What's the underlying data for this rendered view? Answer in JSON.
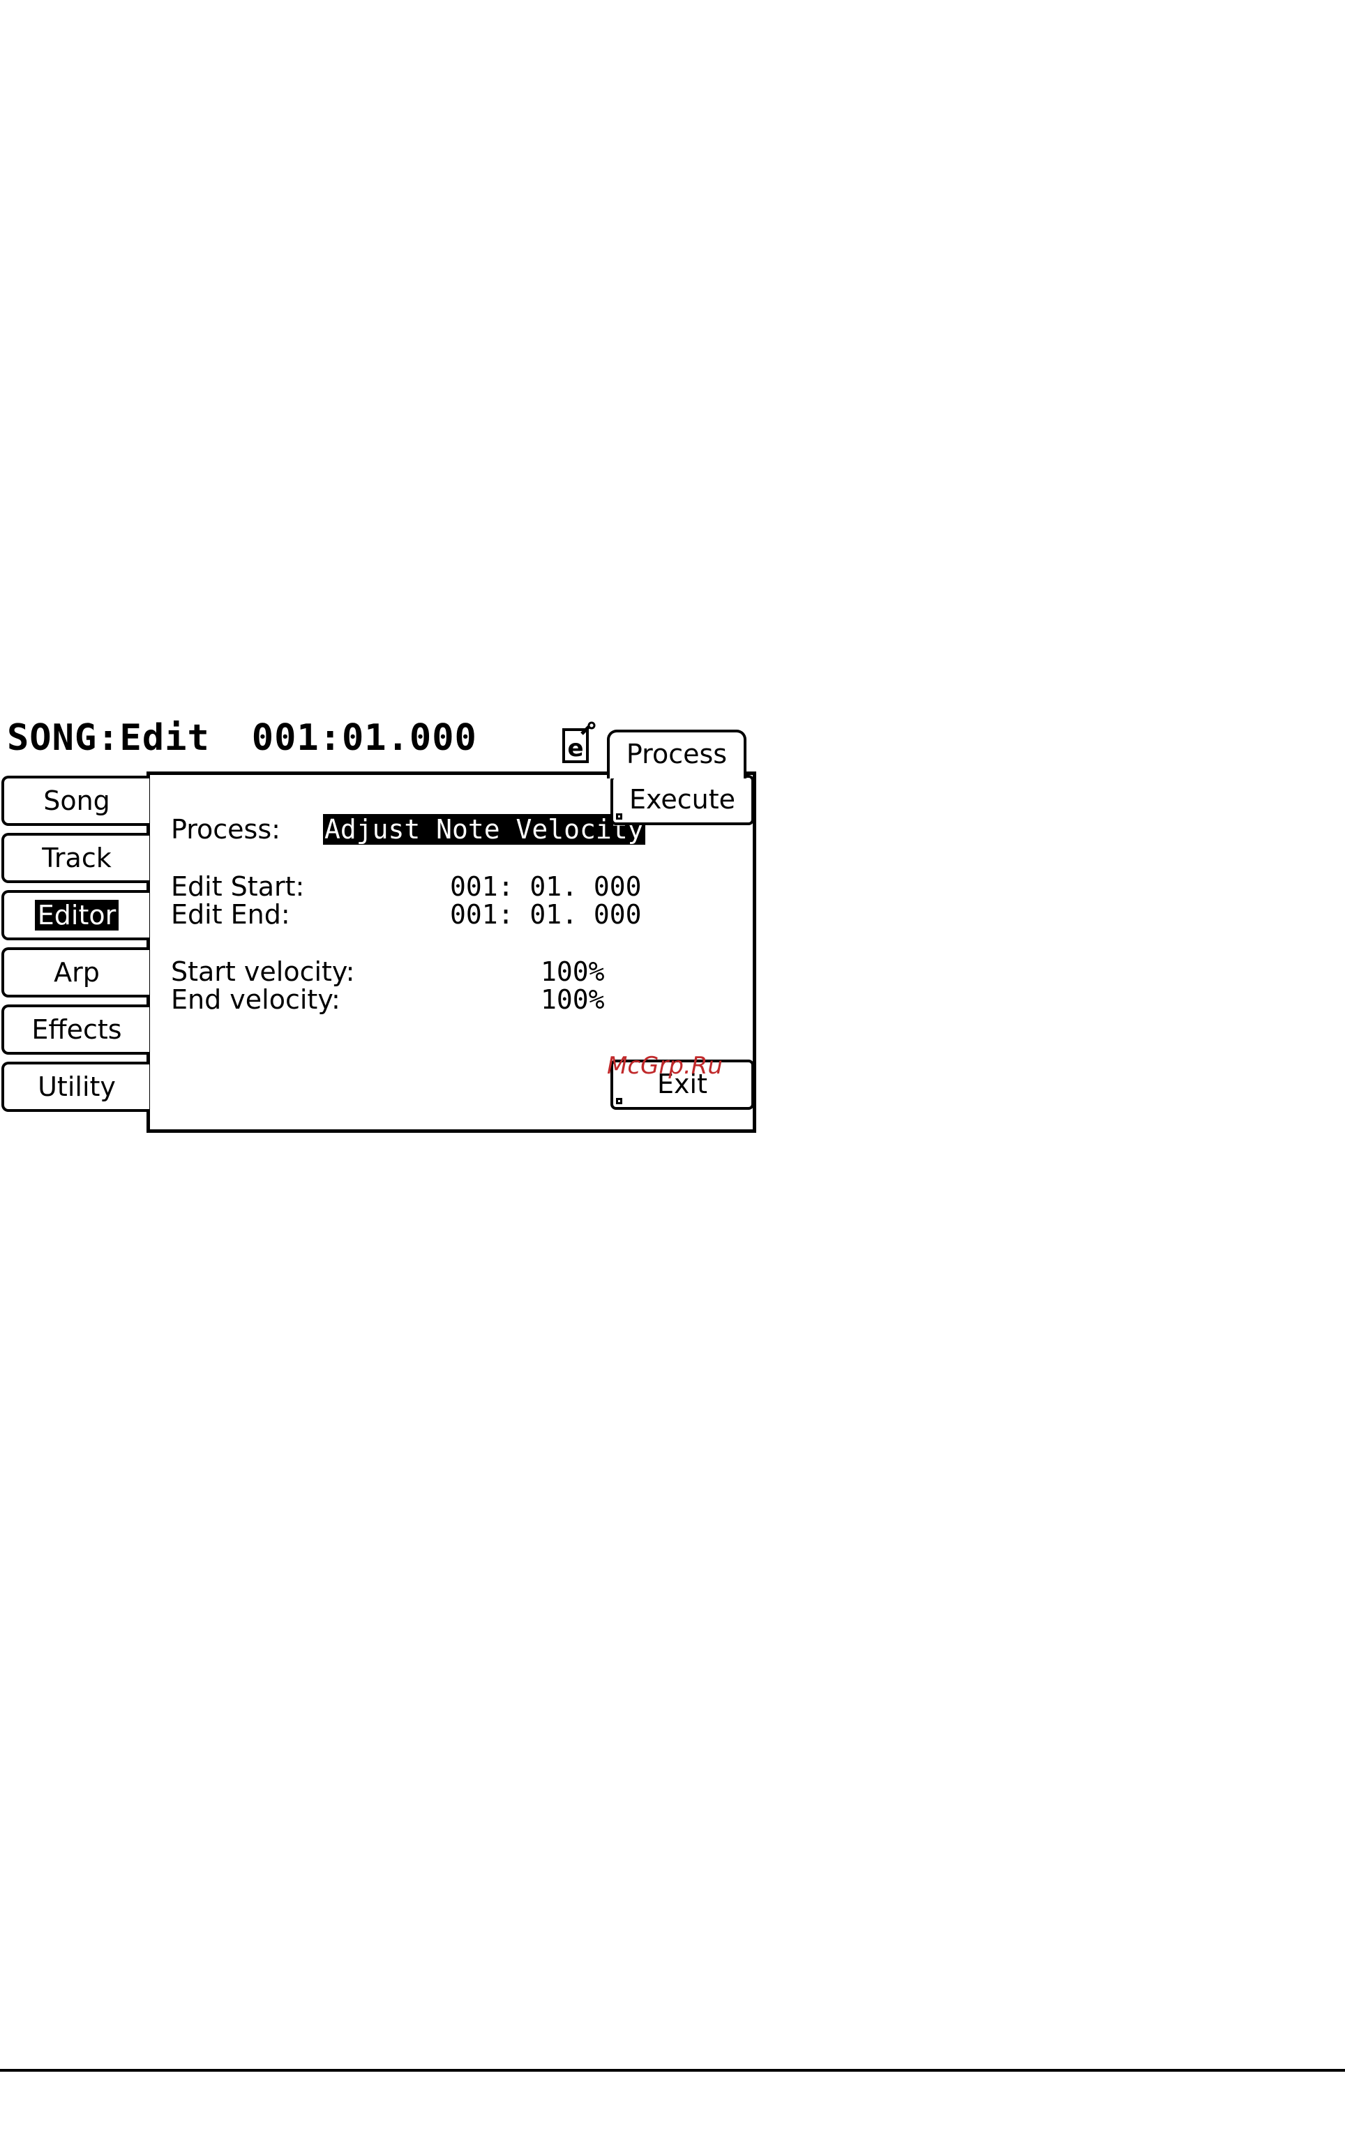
{
  "header": {
    "title": "SONG:Edit",
    "position": "001:01.000"
  },
  "tabs": {
    "process": "Process"
  },
  "side_tabs": [
    {
      "label": "Song",
      "active": false
    },
    {
      "label": "Track",
      "active": false
    },
    {
      "label": "Editor",
      "active": true
    },
    {
      "label": "Arp",
      "active": false
    },
    {
      "label": "Effects",
      "active": false
    },
    {
      "label": "Utility",
      "active": false
    }
  ],
  "panel": {
    "process_label": "Process:",
    "process_value": "Adjust Note Velocity",
    "edit_start_label": "Edit Start:",
    "edit_start_value": "001: 01. 000",
    "edit_end_label": "Edit End:",
    "edit_end_value": "001: 01. 000",
    "start_velocity_label": "Start velocity:",
    "start_velocity_value": "100%",
    "end_velocity_label": "End velocity:",
    "end_velocity_value": "100%"
  },
  "buttons": {
    "execute": "Execute",
    "exit": "Exit"
  },
  "watermark": "McGrp.Ru",
  "icons": {
    "edit": "edit-document-icon"
  }
}
